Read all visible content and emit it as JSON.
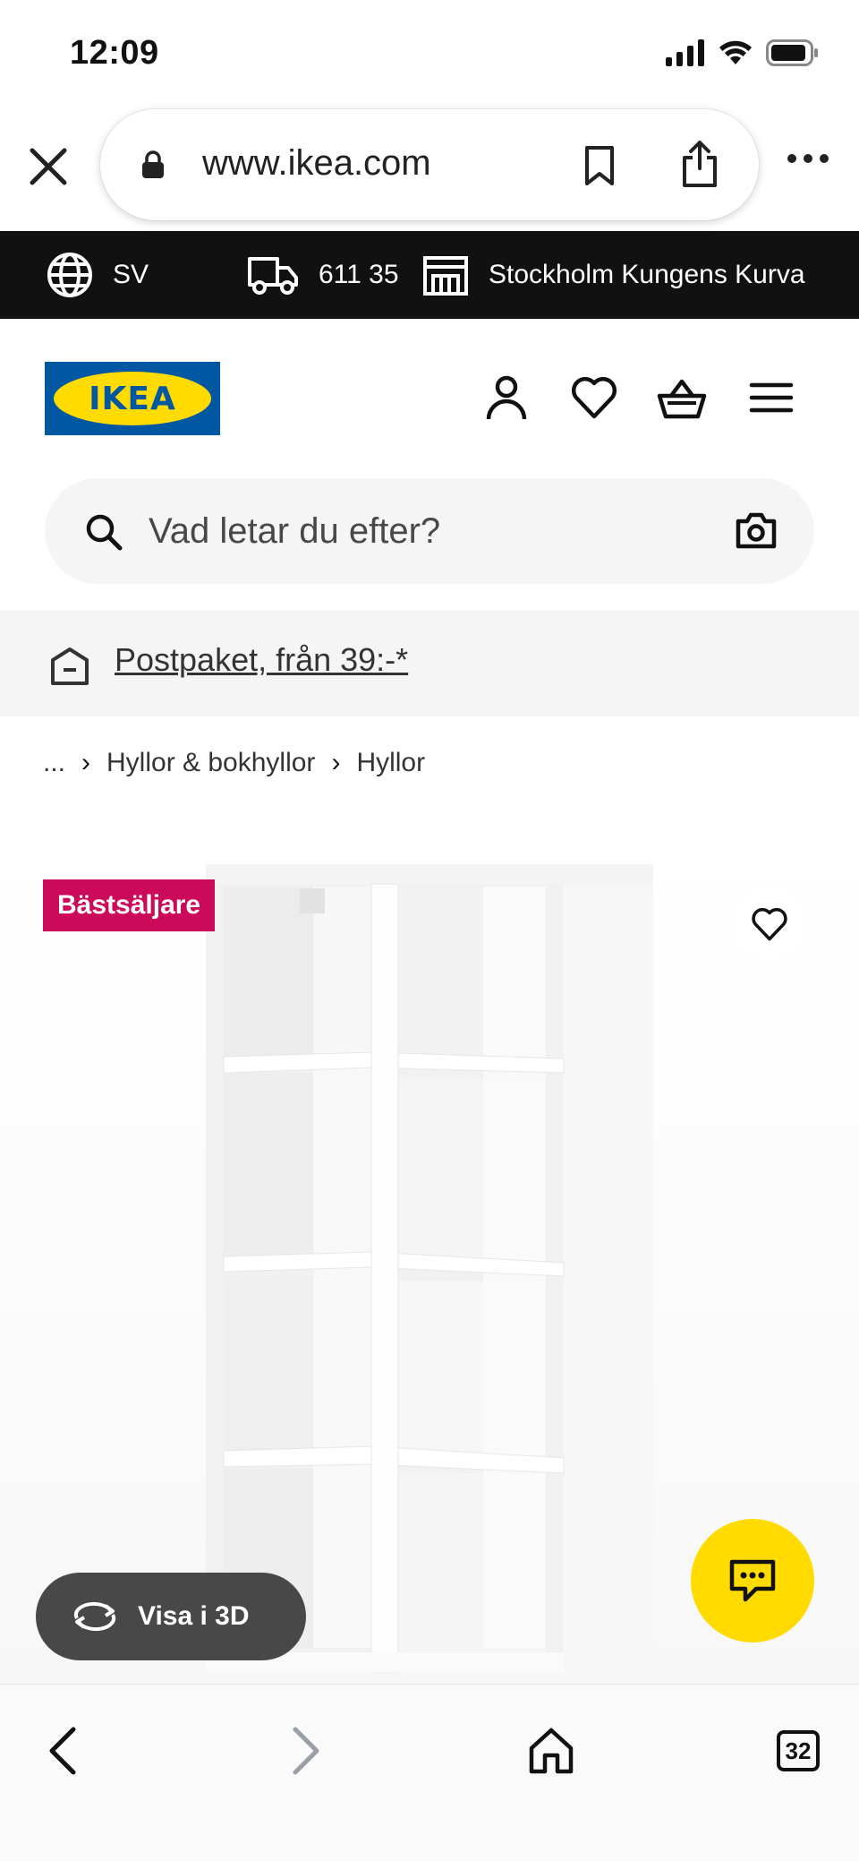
{
  "status_bar": {
    "time": "12:09"
  },
  "browser": {
    "url": "www.ikea.com",
    "icons": {
      "close": "close-icon",
      "lock": "lock-icon",
      "bookmark": "bookmark-icon",
      "share": "share-icon",
      "more": "more-icon"
    }
  },
  "info_bar": {
    "language": "SV",
    "postal_code": "611 35",
    "store": "Stockholm Kungens Kurva",
    "background": "#111111"
  },
  "header": {
    "logo_text": "IKEA",
    "icons": [
      "account-icon",
      "heart-icon",
      "basket-icon",
      "menu-icon"
    ],
    "colors": {
      "blue": "#0058A3",
      "yellow": "#FFDB00"
    }
  },
  "search": {
    "placeholder": "Vad letar du efter?"
  },
  "promo": {
    "text": "Postpaket, från 39:-*"
  },
  "breadcrumb": {
    "ellipsis": "...",
    "items": [
      "Hyllor & bokhyllor",
      "Hyllor"
    ]
  },
  "product": {
    "badge": "Bästsäljare",
    "badge_color": "#CC0A5A",
    "view_3d_label": "Visa i 3D",
    "chat_color": "#FFDB00"
  },
  "toolbar": {
    "tabs_count": "32"
  }
}
